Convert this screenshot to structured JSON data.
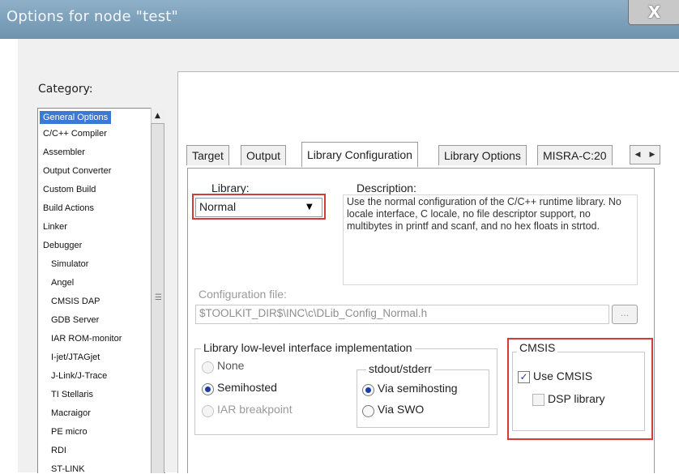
{
  "window": {
    "title": "Options for node \"test\"",
    "close_label": "X"
  },
  "category": {
    "label": "Category:",
    "items": [
      "General Options",
      "C/C++ Compiler",
      "Assembler",
      "Output Converter",
      "Custom Build",
      "Build Actions",
      "Linker",
      "Debugger",
      "Simulator",
      "Angel",
      "CMSIS DAP",
      "GDB Server",
      "IAR ROM-monitor",
      "I-jet/JTAGjet",
      "J-Link/J-Trace",
      "TI Stellaris",
      "Macraigor",
      "PE micro",
      "RDI",
      "ST-LINK"
    ],
    "selected": "General Options"
  },
  "tabs": [
    "Target",
    "Output",
    "Library Configuration",
    "Library Options",
    "MISRA-C:20"
  ],
  "active_tab": "Library Configuration",
  "library": {
    "label": "Library:",
    "value": "Normal",
    "description_label": "Description:",
    "description": "Use the normal configuration of the C/C++ runtime library. No locale interface, C locale, no file descriptor support, no multibytes in printf and scanf, and no hex floats in strtod."
  },
  "config_file": {
    "label": "Configuration file:",
    "value": "$TOOLKIT_DIR$\\INC\\c\\DLib_Config_Normal.h",
    "browse_label": "..."
  },
  "low_level": {
    "title": "Library low-level interface implementation",
    "options": [
      "None",
      "Semihosted",
      "IAR breakpoint"
    ],
    "selected": "Semihosted",
    "stdout_title": "stdout/stderr",
    "stdout_options": [
      "Via semihosting",
      "Via SWO"
    ],
    "stdout_selected": "Via semihosting"
  },
  "cmsis": {
    "title": "CMSIS",
    "use_cmsis_label": "Use CMSIS",
    "use_cmsis_checked": true,
    "dsp_label": "DSP library",
    "dsp_checked": false
  },
  "colors": {
    "highlight_box": "#d43a3a",
    "selection": "#3b79d6",
    "titlebar": "#7fa3bd"
  }
}
